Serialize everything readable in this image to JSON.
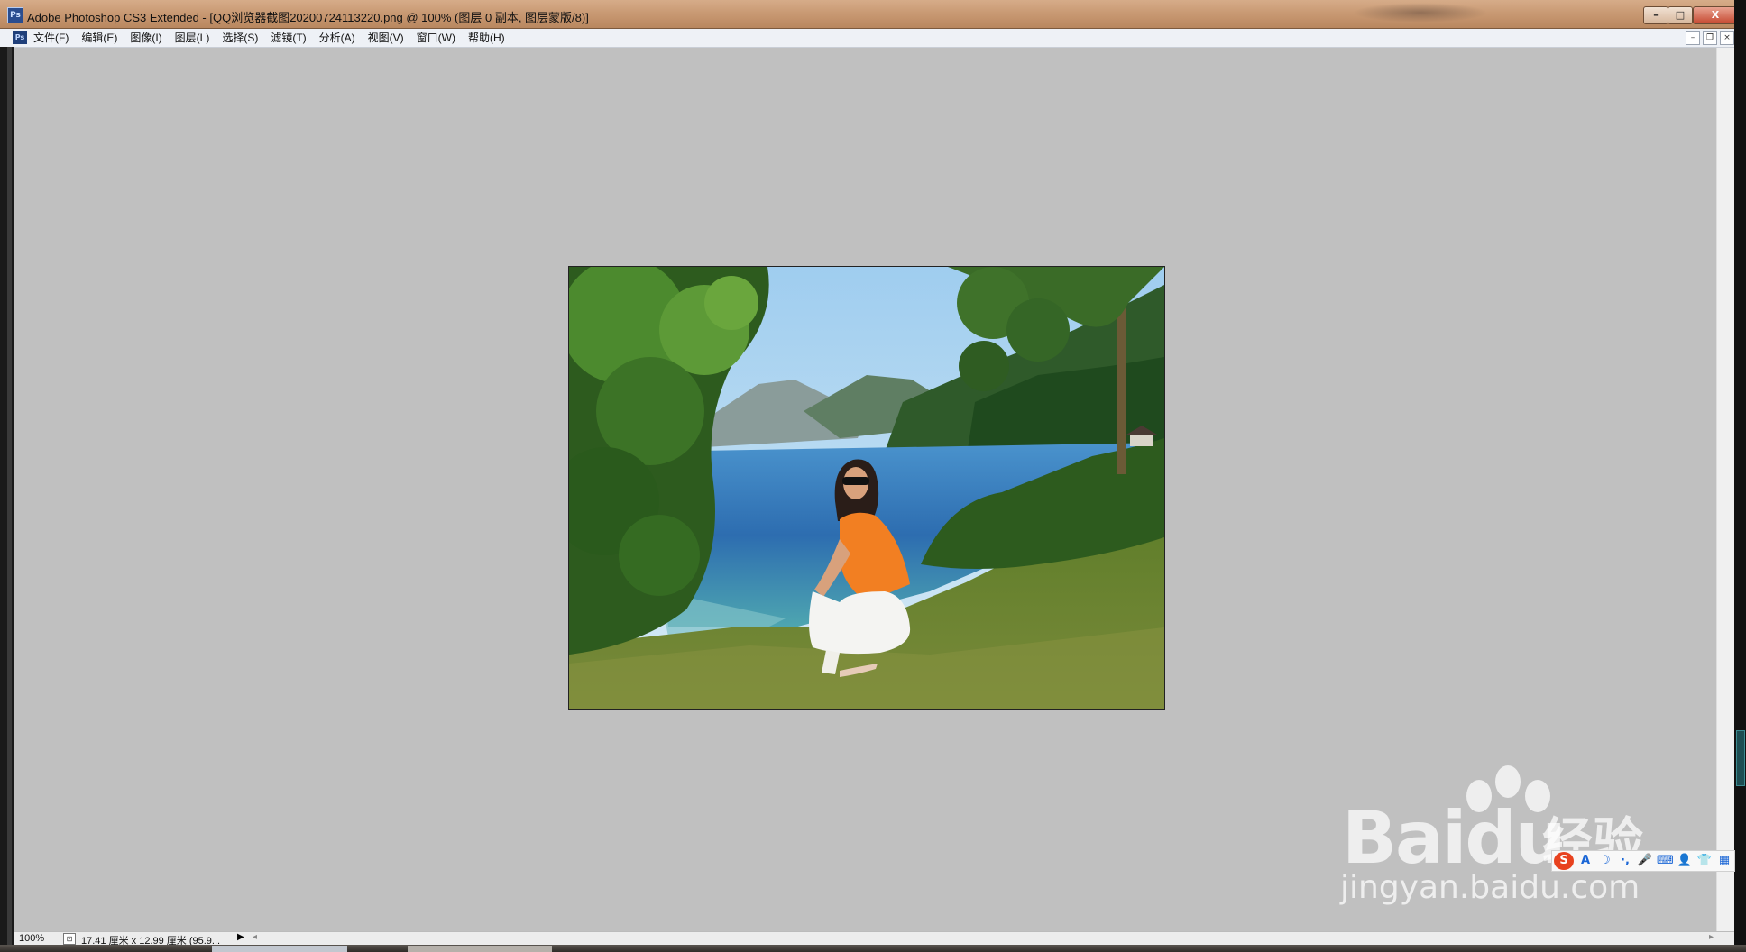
{
  "window": {
    "title": "Adobe Photoshop CS3 Extended - [QQ浏览器截图20200724113220.png @ 100% (图层 0 副本, 图层蒙版/8)]",
    "app_icon": "Ps",
    "controls": {
      "minimize": "–",
      "maximize": "□",
      "close": "X"
    }
  },
  "menu": {
    "icon": "Ps",
    "items": [
      "文件(F)",
      "编辑(E)",
      "图像(I)",
      "图层(L)",
      "选择(S)",
      "滤镜(T)",
      "分析(A)",
      "视图(V)",
      "窗口(W)",
      "帮助(H)"
    ],
    "doc_controls": {
      "minimize": "–",
      "restore": "❐",
      "close": "×"
    }
  },
  "status": {
    "zoom": "100%",
    "doc_info": "17.41 厘米 x 12.99 厘米 (95.9...",
    "arrow": "▶",
    "scroll_left": "◂",
    "scroll_right": "▸"
  },
  "canvas": {
    "content": "photo-woman-crouching-by-alpine-lake",
    "colors": {
      "sky": "#b9dcf2",
      "lake": "#2f78b8",
      "grass": "#6f8a34",
      "shirt": "#f27f22"
    }
  },
  "watermark": {
    "brand": "Bai",
    "brand_suffix": "du",
    "chinese": "经验",
    "url": "jingyan.baidu.com"
  },
  "ime": {
    "logo": "S",
    "icons": [
      "A",
      "☽",
      "·,",
      "🎤",
      "⌨",
      "👤",
      "👕",
      "▦"
    ]
  }
}
